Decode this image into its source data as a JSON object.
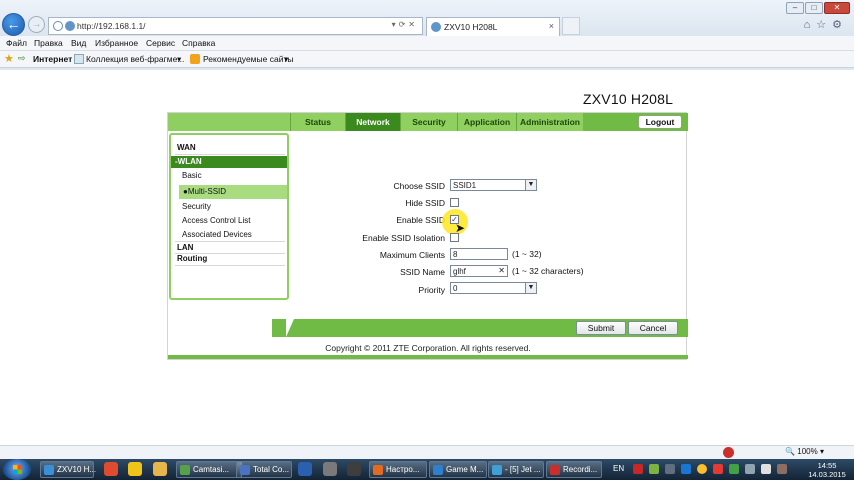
{
  "browser": {
    "url": "http://192.168.1.1/",
    "tab_title": "ZXV10 H208L",
    "menu": [
      "Файл",
      "Правка",
      "Вид",
      "Избранное",
      "Сервис",
      "Справка"
    ],
    "favorites": {
      "internet": "Интернет",
      "collection": "Коллекция веб-фрагме...",
      "recommended": "Рекомендуемые сайты"
    },
    "zoom": "100%"
  },
  "router": {
    "model": "ZXV10 H208L",
    "nav_tabs": [
      "Status",
      "Network",
      "Security",
      "Application",
      "Administration"
    ],
    "active_tab": "Network",
    "logout": "Logout",
    "sidebar": {
      "wan": "WAN",
      "wlan": "-WLAN",
      "basic": "Basic",
      "multi_ssid": "●Multi-SSID",
      "security": "Security",
      "acl": "Access Control List",
      "associated": "Associated Devices",
      "lan": "LAN",
      "routing": "Routing"
    },
    "form": {
      "choose_ssid_label": "Choose SSID",
      "choose_ssid_value": "SSID1",
      "hide_ssid_label": "Hide SSID",
      "enable_ssid_label": "Enable SSID",
      "enable_isolation_label": "Enable SSID Isolation",
      "max_clients_label": "Maximum Clients",
      "max_clients_value": "8",
      "max_clients_hint": "(1 ~ 32)",
      "ssid_name_label": "SSID Name",
      "ssid_name_value": "glhf",
      "ssid_name_hint": "(1 ~ 32 characters)",
      "priority_label": "Priority",
      "priority_value": "0",
      "hide_ssid_checked": false,
      "enable_ssid_checked": true,
      "isolation_checked": false
    },
    "buttons": {
      "submit": "Submit",
      "cancel": "Cancel"
    },
    "copyright": "Copyright © 2011 ZTE Corporation. All rights reserved."
  },
  "taskbar": {
    "items": [
      "ZXV10 H...",
      "Camtasi...",
      "Total Co...",
      "Настро...",
      "Game M...",
      "- [5] Jet ...",
      "Recordi..."
    ],
    "language": "EN",
    "time": "14:55",
    "date": "14.03.2015"
  },
  "colors": {
    "green_dark": "#3b8a1e",
    "green_mid": "#6fbb45",
    "green_light": "#8fd061"
  }
}
